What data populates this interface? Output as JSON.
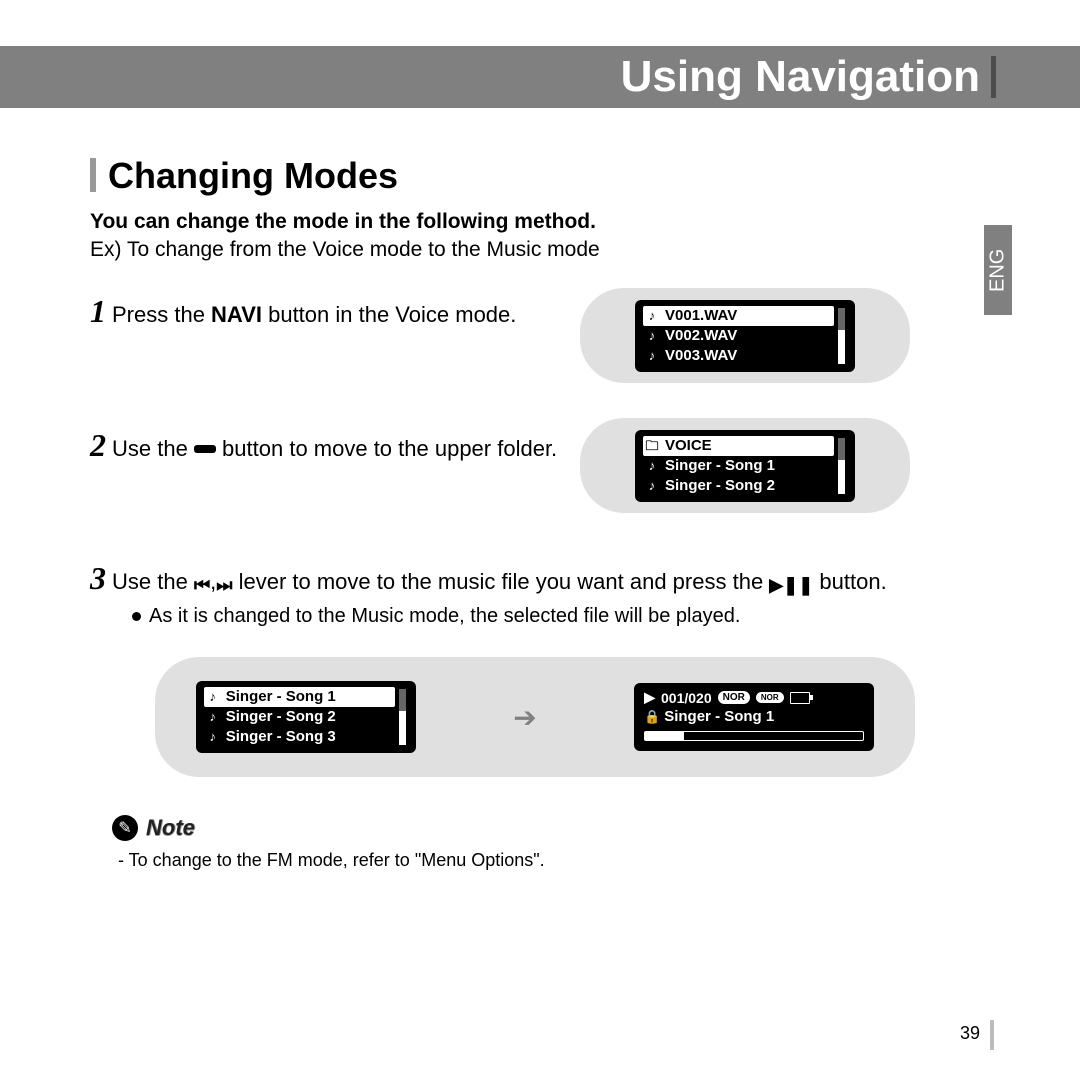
{
  "header": {
    "title": "Using Navigation"
  },
  "lang_tab": "ENG",
  "section": {
    "heading": "Changing Modes"
  },
  "intro": {
    "line1": "You can change the mode in the following method.",
    "line2": "Ex) To change from the Voice mode to the Music mode"
  },
  "steps": {
    "s1": {
      "num": "1",
      "pre": "Press the ",
      "strong": "NAVI",
      "post": " button in the Voice mode."
    },
    "s2": {
      "num": "2",
      "pre": "Use the ",
      "post": " button to move to the upper folder."
    },
    "s3": {
      "num": "3",
      "part1": "Use the ",
      "part2": " lever to move to the music file you want and press the ",
      "part3": " button."
    }
  },
  "bullet": "As it is changed to the Music mode, the selected file will be played.",
  "screens": {
    "voice_files": {
      "items": [
        "V001.WAV",
        "V002.WAV",
        "V003.WAV"
      ],
      "selected_index": 0
    },
    "folder_view": {
      "folder": "VOICE",
      "items": [
        "Singer - Song 1",
        "Singer - Song 2"
      ],
      "selected_index": -1,
      "folder_selected": true
    },
    "music_list": {
      "items": [
        "Singer - Song 1",
        "Singer - Song 2",
        "Singer - Song 3"
      ],
      "selected_index": 0
    },
    "now_playing": {
      "counter": "001/020",
      "eq_badge": "NOR",
      "lock_badge": "NOR",
      "title": "Singer - Song 1"
    }
  },
  "note": {
    "label": "Note",
    "text": "- To change to the FM mode, refer to \"Menu Options\"."
  },
  "page_number": "39",
  "icons": {
    "music_note": "♪",
    "folder": "🗀",
    "prev": "⏮",
    "next": "⏭",
    "playpause": "▶❚❚",
    "lock": "🔒",
    "play_small": "▶",
    "pencil": "✎",
    "comma": ","
  }
}
